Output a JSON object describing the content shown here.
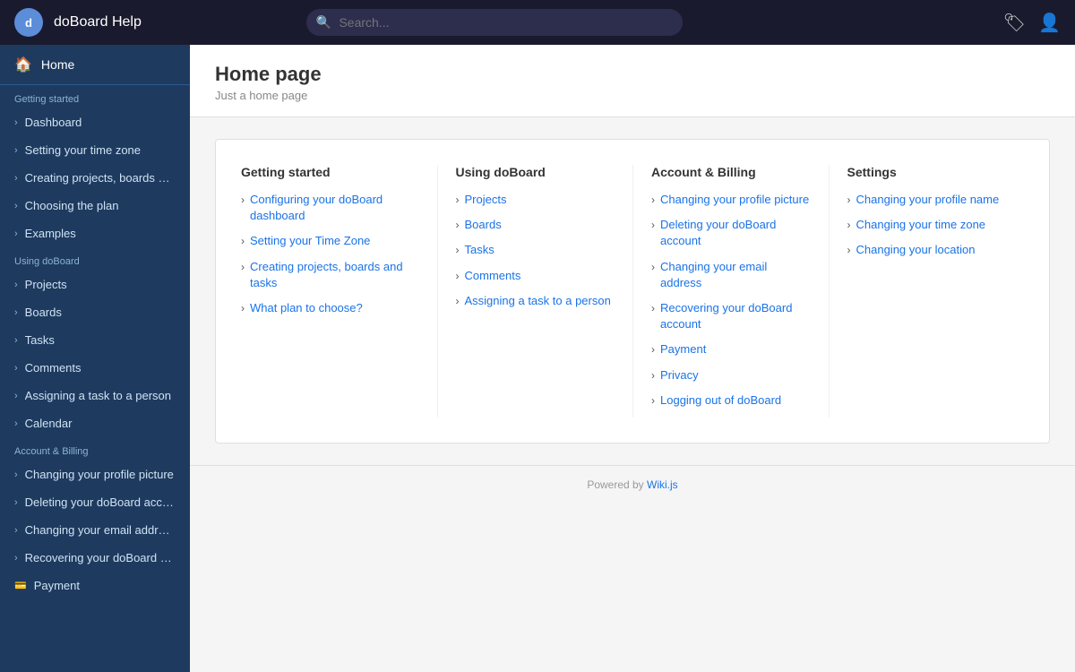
{
  "app": {
    "title": "doBoard Help",
    "logo_initials": "d"
  },
  "navbar": {
    "search_placeholder": "Search...",
    "tags_icon": "🏷",
    "user_icon": "👤"
  },
  "sidebar": {
    "home_label": "Home",
    "sections": [
      {
        "label": "Getting started",
        "items": [
          {
            "label": "Dashboard",
            "id": "dashboard"
          },
          {
            "label": "Setting your time zone",
            "id": "time-zone"
          },
          {
            "label": "Creating projects, boards and ...",
            "id": "creating-projects"
          },
          {
            "label": "Choosing the plan",
            "id": "choosing-plan"
          },
          {
            "label": "Examples",
            "id": "examples"
          }
        ]
      },
      {
        "label": "Using doBoard",
        "items": [
          {
            "label": "Projects",
            "id": "projects"
          },
          {
            "label": "Boards",
            "id": "boards"
          },
          {
            "label": "Tasks",
            "id": "tasks"
          },
          {
            "label": "Comments",
            "id": "comments"
          },
          {
            "label": "Assigning a task to a person",
            "id": "assigning-task"
          },
          {
            "label": "Calendar",
            "id": "calendar"
          }
        ]
      },
      {
        "label": "Account & Billing",
        "items": [
          {
            "label": "Changing your profile picture",
            "id": "profile-picture"
          },
          {
            "label": "Deleting your doBoard account",
            "id": "delete-account"
          },
          {
            "label": "Changing your email address",
            "id": "email-address"
          },
          {
            "label": "Recovering your doBoard acc...",
            "id": "recover-account"
          },
          {
            "label": "Payment",
            "id": "payment"
          }
        ]
      }
    ]
  },
  "page": {
    "title": "Home page",
    "subtitle": "Just a home page"
  },
  "content_grid": {
    "sections": [
      {
        "id": "getting-started",
        "title": "Getting started",
        "links": [
          {
            "label": "Configuring your doBoard dashboard",
            "href": "#"
          },
          {
            "label": "Setting your Time Zone",
            "href": "#"
          },
          {
            "label": "Creating projects, boards and tasks",
            "href": "#"
          },
          {
            "label": "What plan to choose?",
            "href": "#"
          }
        ]
      },
      {
        "id": "using-doboard",
        "title": "Using doBoard",
        "links": [
          {
            "label": "Projects",
            "href": "#"
          },
          {
            "label": "Boards",
            "href": "#"
          },
          {
            "label": "Tasks",
            "href": "#"
          },
          {
            "label": "Comments",
            "href": "#"
          },
          {
            "label": "Assigning a task to a person",
            "href": "#"
          }
        ]
      },
      {
        "id": "account-billing",
        "title": "Account & Billing",
        "links": [
          {
            "label": "Changing your profile picture",
            "href": "#"
          },
          {
            "label": "Deleting your doBoard account",
            "href": "#"
          },
          {
            "label": "Changing your email address",
            "href": "#"
          },
          {
            "label": "Recovering your doBoard account",
            "href": "#"
          },
          {
            "label": "Payment",
            "href": "#"
          },
          {
            "label": "Privacy",
            "href": "#"
          },
          {
            "label": "Logging out of doBoard",
            "href": "#"
          }
        ]
      },
      {
        "id": "settings",
        "title": "Settings",
        "links": [
          {
            "label": "Changing your profile name",
            "href": "#"
          },
          {
            "label": "Changing your time zone",
            "href": "#"
          },
          {
            "label": "Changing your location",
            "href": "#"
          }
        ]
      }
    ]
  },
  "footer": {
    "text": "Powered by ",
    "link_label": "Wiki.js"
  }
}
